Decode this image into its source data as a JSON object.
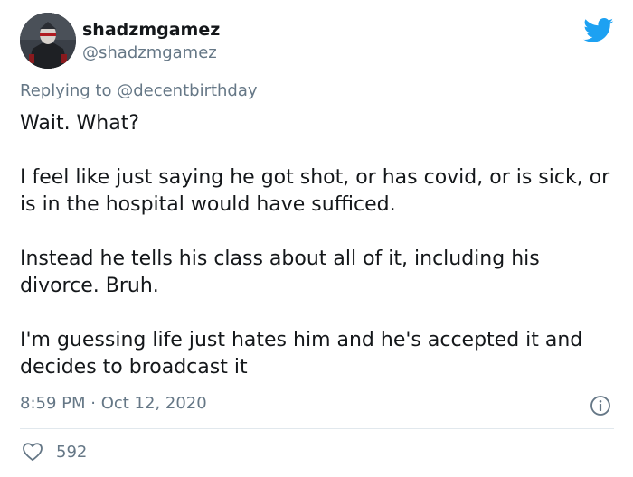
{
  "tweet": {
    "display_name": "shadzmgamez",
    "handle": "@shadzmgamez",
    "reply_prefix": "Replying to ",
    "reply_to": "@decentbirthday",
    "paragraphs": [
      "Wait. What?",
      "I feel like just saying he got shot, or has covid, or is sick, or is in the hospital would have sufficed.",
      "Instead he tells his class about all of it, including his divorce. Bruh.",
      "I'm guessing life just hates him and he's accepted it and decides to broadcast it"
    ],
    "timestamp": "8:59 PM · Oct 12, 2020",
    "like_count": "592"
  },
  "icons": {
    "brand": "twitter-bird-icon",
    "info": "info-icon",
    "like": "heart-icon"
  },
  "colors": {
    "brand_blue": "#1da1f2",
    "secondary_text": "#657786",
    "primary_text": "#14171a",
    "divider": "#e1e8ed"
  }
}
